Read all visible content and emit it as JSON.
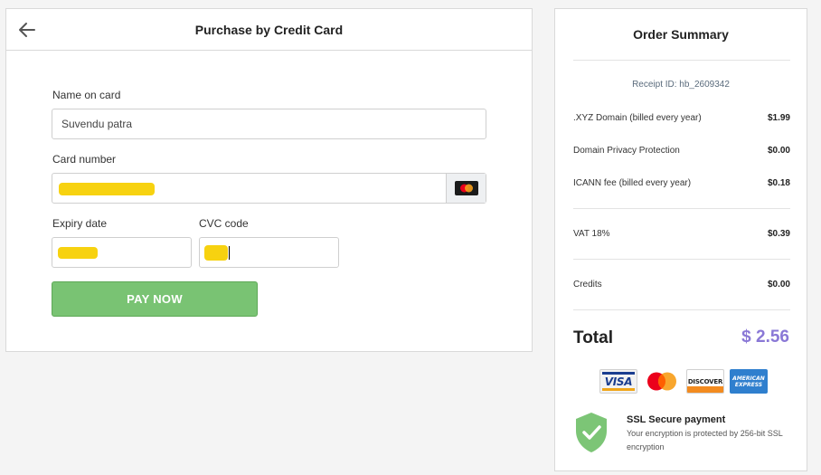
{
  "payment": {
    "title": "Purchase by Credit Card",
    "name_label": "Name on card",
    "name_value": "Suvendu patra",
    "card_number_label": "Card number",
    "expiry_label": "Expiry date",
    "cvc_label": "CVC code",
    "pay_button": "PAY NOW"
  },
  "summary": {
    "title": "Order Summary",
    "receipt": "Receipt ID: hb_2609342",
    "items": [
      {
        "label": ".XYZ Domain (billed every year)",
        "amount": "$1.99"
      },
      {
        "label": "Domain Privacy Protection",
        "amount": "$0.00"
      },
      {
        "label": "ICANN fee (billed every year)",
        "amount": "$0.18"
      },
      {
        "label": "VAT 18%",
        "amount": "$0.39"
      },
      {
        "label": "Credits",
        "amount": "$0.00"
      }
    ],
    "total_label": "Total",
    "total_value": "$ 2.56",
    "card_logos": {
      "visa": "VISA",
      "discover": "DISCOVER",
      "amex_line1": "AMERICAN",
      "amex_line2": "EXPRESS"
    },
    "ssl_title": "SSL Secure payment",
    "ssl_text": "Your encryption is protected by 256-bit SSL encryption"
  },
  "colors": {
    "pay_button": "#79c373",
    "total_value": "#8a78d6",
    "redaction": "#f7d210",
    "shield": "#7cc576"
  },
  "icons": {
    "back": "arrow-left-icon",
    "card_type": "mastercard-icon",
    "ssl": "shield-check-icon"
  }
}
